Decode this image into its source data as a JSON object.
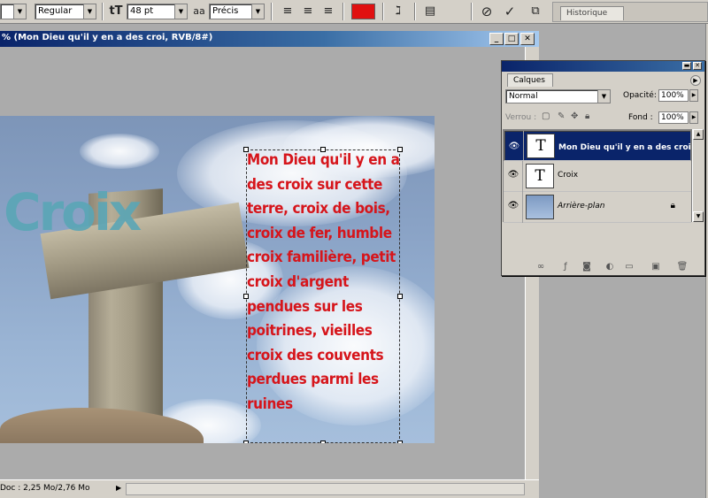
{
  "options_bar": {
    "font_style": "Regular",
    "font_size_icon": "tT",
    "font_size": "48 pt",
    "antialias_icon": "aa",
    "antialias": "Précis",
    "text_color": "#e01010",
    "history_tab": "Historique"
  },
  "document": {
    "title": "% (Mon Dieu qu'il y en a des croi, RVB/8#)",
    "status": "Doc : 2,25 Mo/2,76 Mo",
    "image_word": "Croix",
    "image_text": "Mon Dieu qu'il y en a des croix sur cette terre, croix de bois, croix de fer, humble croix familière, petit croix d'argent pendues sur les poitrines, vieilles croix des couvents perdues parmi les ruines"
  },
  "layers_palette": {
    "tab": "Calques",
    "blend_mode": "Normal",
    "opacity_label": "Opacité:",
    "opacity": "100%",
    "lock_label": "Verrou :",
    "fill_label": "Fond :",
    "fill": "100%",
    "layers": [
      {
        "name": "Mon Dieu qu'il y en a des croi",
        "type": "text",
        "selected": true
      },
      {
        "name": "Croix",
        "type": "text",
        "selected": false
      },
      {
        "name": "Arrière-plan",
        "type": "image",
        "selected": false
      }
    ]
  },
  "colors": {
    "title_bar": "#0a246a",
    "chrome": "#d4d0c8",
    "text_red": "#d6151b"
  }
}
